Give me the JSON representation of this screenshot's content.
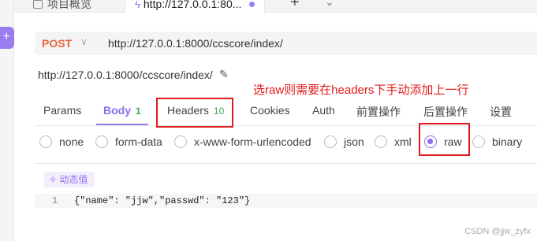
{
  "tabs": [
    {
      "label": "项目概览"
    },
    {
      "label": "http://127.0.0.1:80..."
    }
  ],
  "request": {
    "method": "POST",
    "url": "http://127.0.0.1:8000/ccscore/index/",
    "path_display": "http://127.0.0.1:8000/ccscore/index/"
  },
  "annotation": "选raw则需要在headers下手动添加上一行",
  "request_tabs": [
    {
      "label": "Params"
    },
    {
      "label": "Body",
      "count": "1"
    },
    {
      "label": "Headers",
      "count": "10"
    },
    {
      "label": "Cookies"
    },
    {
      "label": "Auth"
    },
    {
      "label": "前置操作"
    },
    {
      "label": "后置操作"
    },
    {
      "label": "设置"
    }
  ],
  "body_types": [
    {
      "label": "none"
    },
    {
      "label": "form-data"
    },
    {
      "label": "x-www-form-urlencoded"
    },
    {
      "label": "json"
    },
    {
      "label": "xml"
    },
    {
      "label": "raw"
    },
    {
      "label": "binary"
    }
  ],
  "selected_body_type": "raw",
  "editor": {
    "dynamic_button": "动态值",
    "lines": [
      {
        "number": "1",
        "code": "{\"name\": \"jjw\",\"passwd\": \"123\"}"
      }
    ]
  },
  "watermark": "CSDN @jjw_zyfx",
  "colors": {
    "accent": "#8c6ff0",
    "method": "#e8683d",
    "annotation": "#e21a1a",
    "count": "#3aa55b"
  }
}
